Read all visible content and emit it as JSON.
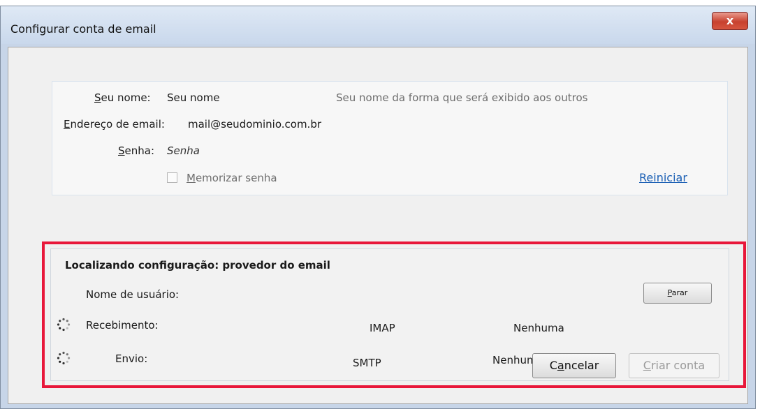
{
  "window": {
    "title": "Configurar conta de email",
    "close_glyph": "x"
  },
  "form": {
    "name_label": {
      "access_key": "S",
      "rest": "eu nome:"
    },
    "name_value": "Seu nome",
    "name_hint": "Seu nome da forma que será exibido aos outros",
    "email_label": {
      "access_key": "E",
      "rest": "ndereço de email:"
    },
    "email_value": "mail@seudominio.com.br",
    "password_label": {
      "access_key": "S",
      "rest": "enha:"
    },
    "password_value": "Senha",
    "remember_label": {
      "access_key": "M",
      "rest": "emorizar senha"
    },
    "remember_checked": false,
    "reset_link": "Reiniciar"
  },
  "status": {
    "heading": "Localizando configuração: provedor do email",
    "username_label": "Nome de usuário:",
    "stop_button": {
      "access_key": "P",
      "rest": "arar"
    },
    "incoming": {
      "label": "Recebimento:",
      "protocol": "IMAP",
      "security": "Nenhuma",
      "icon": "spinner-icon"
    },
    "outgoing": {
      "label": "Envio:",
      "protocol": "SMTP",
      "security": "Nenhuma",
      "icon": "spinner-icon"
    }
  },
  "buttons": {
    "cancel": {
      "access_key": "a",
      "prefix": "C",
      "rest": "ncelar"
    },
    "create": {
      "access_key": "C",
      "rest": "riar conta"
    }
  },
  "colors": {
    "highlight": "#e8173a",
    "link": "#1a5fb4"
  }
}
